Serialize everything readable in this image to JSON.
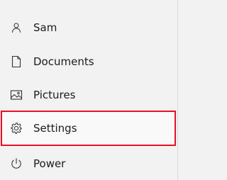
{
  "menu": {
    "items": [
      {
        "label": "Sam",
        "icon": "person-icon"
      },
      {
        "label": "Documents",
        "icon": "document-icon"
      },
      {
        "label": "Pictures",
        "icon": "picture-icon"
      },
      {
        "label": "Settings",
        "icon": "gear-icon",
        "highlighted": true
      },
      {
        "label": "Power",
        "icon": "power-icon"
      }
    ]
  },
  "colors": {
    "background": "#f2f2f2",
    "highlight_border": "#e81123",
    "text": "#1b1b1b"
  }
}
